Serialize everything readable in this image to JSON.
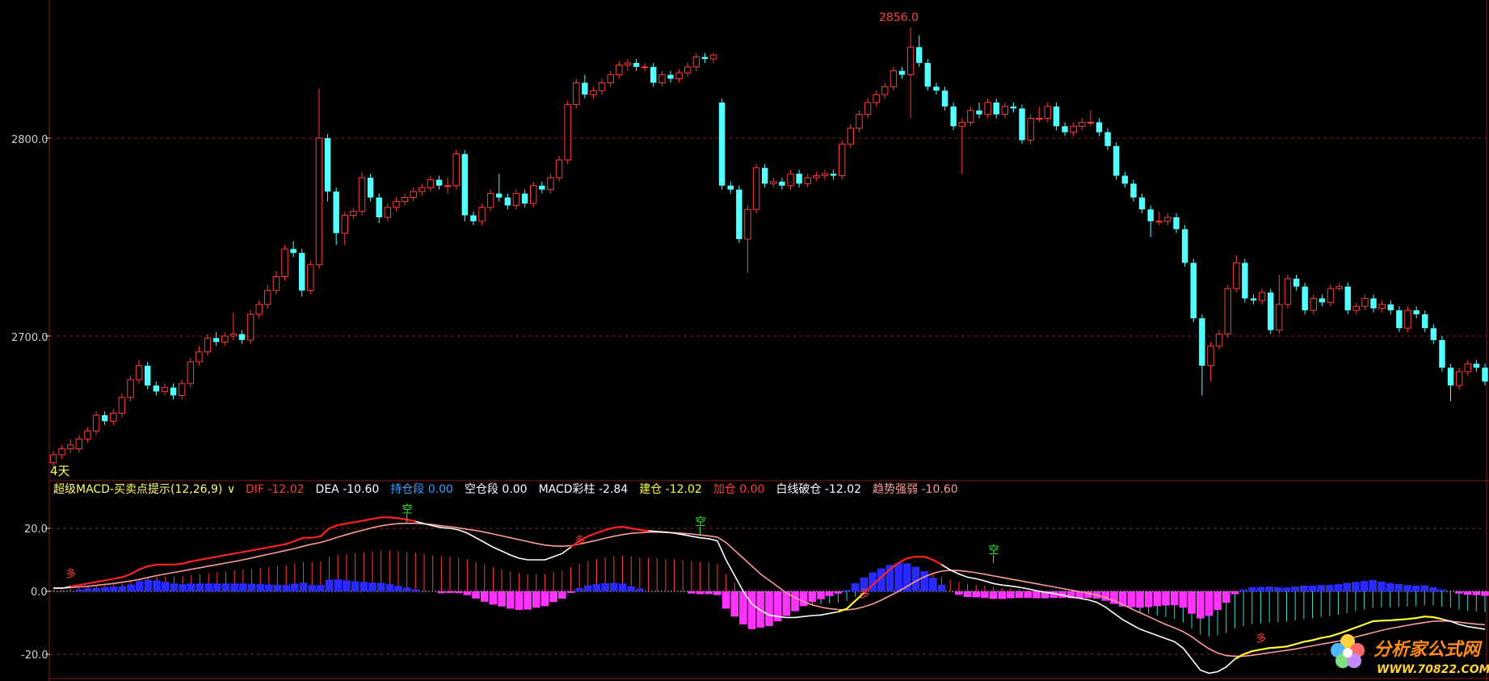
{
  "chart_data": {
    "type": "candlestick",
    "period_label": "4天",
    "price_axis": {
      "ticks": [
        "2800.0",
        "2700.0"
      ],
      "tick_values": [
        2800,
        2700
      ],
      "ylim": [
        2630,
        2875
      ],
      "gridlines": true
    },
    "high_marker": {
      "label": "2856.0",
      "value": 2856.0
    },
    "candles": [
      [
        2636,
        2640,
        2634,
        2642
      ],
      [
        2640,
        2643,
        2638,
        2645
      ],
      [
        2643,
        2645,
        2641,
        2648
      ],
      [
        2643,
        2648,
        2641,
        2650
      ],
      [
        2648,
        2652,
        2646,
        2654
      ],
      [
        2652,
        2660,
        2650,
        2662
      ],
      [
        2660,
        2657,
        2655,
        2662
      ],
      [
        2657,
        2661,
        2655,
        2663
      ],
      [
        2661,
        2669,
        2659,
        2671
      ],
      [
        2669,
        2678,
        2667,
        2680
      ],
      [
        2678,
        2685,
        2676,
        2688
      ],
      [
        2685,
        2675,
        2673,
        2687
      ],
      [
        2675,
        2672,
        2670,
        2677
      ],
      [
        2672,
        2674,
        2670,
        2676
      ],
      [
        2674,
        2670,
        2668,
        2676
      ],
      [
        2670,
        2676,
        2668,
        2678
      ],
      [
        2676,
        2687,
        2674,
        2689
      ],
      [
        2687,
        2692,
        2685,
        2695
      ],
      [
        2692,
        2699,
        2690,
        2701
      ],
      [
        2699,
        2697,
        2695,
        2702
      ],
      [
        2697,
        2700,
        2695,
        2702
      ],
      [
        2700,
        2701,
        2698,
        2712
      ],
      [
        2701,
        2698,
        2696,
        2703
      ],
      [
        2698,
        2711,
        2696,
        2713
      ],
      [
        2711,
        2716,
        2709,
        2718
      ],
      [
        2716,
        2723,
        2714,
        2726
      ],
      [
        2723,
        2730,
        2721,
        2733
      ],
      [
        2730,
        2744,
        2728,
        2746
      ],
      [
        2744,
        2742,
        2740,
        2748
      ],
      [
        2742,
        2723,
        2720,
        2744
      ],
      [
        2723,
        2736,
        2721,
        2738
      ],
      [
        2736,
        2800,
        2734,
        2825
      ],
      [
        2800,
        2773,
        2768,
        2802
      ],
      [
        2773,
        2752,
        2746,
        2775
      ],
      [
        2752,
        2761,
        2746,
        2763
      ],
      [
        2761,
        2763,
        2759,
        2765
      ],
      [
        2763,
        2780,
        2761,
        2783
      ],
      [
        2780,
        2770,
        2768,
        2782
      ],
      [
        2770,
        2760,
        2757,
        2772
      ],
      [
        2760,
        2765,
        2758,
        2767
      ],
      [
        2765,
        2768,
        2763,
        2770
      ],
      [
        2768,
        2770,
        2766,
        2772
      ],
      [
        2770,
        2773,
        2768,
        2775
      ],
      [
        2773,
        2775,
        2771,
        2777
      ],
      [
        2775,
        2779,
        2773,
        2781
      ],
      [
        2779,
        2776,
        2774,
        2781
      ],
      [
        2776,
        2776,
        2772,
        2780
      ],
      [
        2776,
        2792,
        2774,
        2794
      ],
      [
        2792,
        2761,
        2758,
        2794
      ],
      [
        2761,
        2758,
        2756,
        2763
      ],
      [
        2758,
        2765,
        2756,
        2767
      ],
      [
        2765,
        2772,
        2763,
        2774
      ],
      [
        2772,
        2770,
        2768,
        2782
      ],
      [
        2770,
        2766,
        2764,
        2772
      ],
      [
        2766,
        2772,
        2764,
        2774
      ],
      [
        2772,
        2767,
        2765,
        2774
      ],
      [
        2767,
        2776,
        2765,
        2778
      ],
      [
        2776,
        2774,
        2772,
        2778
      ],
      [
        2774,
        2780,
        2772,
        2782
      ],
      [
        2780,
        2789,
        2778,
        2791
      ],
      [
        2789,
        2817,
        2787,
        2819
      ],
      [
        2817,
        2828,
        2815,
        2830
      ],
      [
        2828,
        2822,
        2820,
        2832
      ],
      [
        2822,
        2824,
        2820,
        2826
      ],
      [
        2824,
        2828,
        2822,
        2830
      ],
      [
        2828,
        2832,
        2826,
        2834
      ],
      [
        2832,
        2837,
        2830,
        2839
      ],
      [
        2837,
        2838,
        2834,
        2840
      ],
      [
        2838,
        2836,
        2834,
        2840
      ],
      [
        2836,
        2836,
        2834,
        2838
      ],
      [
        2836,
        2828,
        2826,
        2838
      ],
      [
        2828,
        2832,
        2826,
        2834
      ],
      [
        2832,
        2830,
        2828,
        2834
      ],
      [
        2830,
        2833,
        2828,
        2835
      ],
      [
        2833,
        2836,
        2831,
        2838
      ],
      [
        2836,
        2841,
        2834,
        2843
      ],
      [
        2841,
        2840,
        2838,
        2843
      ],
      [
        2840,
        2842,
        2838,
        2843
      ],
      [
        2818,
        2776,
        2774,
        2820
      ],
      [
        2776,
        2774,
        2772,
        2778
      ],
      [
        2774,
        2749,
        2747,
        2776
      ],
      [
        2749,
        2764,
        2732,
        2766
      ],
      [
        2764,
        2785,
        2762,
        2787
      ],
      [
        2785,
        2777,
        2775,
        2787
      ],
      [
        2777,
        2778,
        2775,
        2780
      ],
      [
        2778,
        2776,
        2774,
        2780
      ],
      [
        2776,
        2782,
        2774,
        2784
      ],
      [
        2782,
        2777,
        2775,
        2784
      ],
      [
        2777,
        2780,
        2775,
        2782
      ],
      [
        2780,
        2781,
        2778,
        2783
      ],
      [
        2781,
        2782,
        2779,
        2784
      ],
      [
        2782,
        2781,
        2779,
        2784
      ],
      [
        2781,
        2797,
        2779,
        2799
      ],
      [
        2797,
        2805,
        2795,
        2807
      ],
      [
        2805,
        2812,
        2803,
        2814
      ],
      [
        2812,
        2818,
        2810,
        2820
      ],
      [
        2818,
        2822,
        2816,
        2824
      ],
      [
        2822,
        2826,
        2820,
        2828
      ],
      [
        2826,
        2834,
        2824,
        2836
      ],
      [
        2834,
        2832,
        2830,
        2836
      ],
      [
        2832,
        2846,
        2810,
        2856
      ],
      [
        2846,
        2838,
        2836,
        2852
      ],
      [
        2838,
        2826,
        2824,
        2840
      ],
      [
        2826,
        2824,
        2822,
        2828
      ],
      [
        2824,
        2816,
        2814,
        2826
      ],
      [
        2816,
        2806,
        2804,
        2818
      ],
      [
        2806,
        2808,
        2782,
        2810
      ],
      [
        2808,
        2814,
        2806,
        2816
      ],
      [
        2814,
        2812,
        2810,
        2818
      ],
      [
        2812,
        2818,
        2810,
        2820
      ],
      [
        2818,
        2812,
        2810,
        2820
      ],
      [
        2812,
        2816,
        2810,
        2818
      ],
      [
        2816,
        2815,
        2813,
        2818
      ],
      [
        2815,
        2799,
        2797,
        2817
      ],
      [
        2799,
        2810,
        2797,
        2812
      ],
      [
        2810,
        2810,
        2808,
        2816
      ],
      [
        2810,
        2816,
        2808,
        2818
      ],
      [
        2816,
        2806,
        2804,
        2818
      ],
      [
        2806,
        2803,
        2801,
        2808
      ],
      [
        2803,
        2806,
        2801,
        2808
      ],
      [
        2806,
        2808,
        2804,
        2810
      ],
      [
        2808,
        2808,
        2806,
        2814
      ],
      [
        2808,
        2803,
        2801,
        2810
      ],
      [
        2803,
        2796,
        2794,
        2805
      ],
      [
        2796,
        2781,
        2779,
        2798
      ],
      [
        2781,
        2777,
        2775,
        2783
      ],
      [
        2777,
        2770,
        2768,
        2779
      ],
      [
        2770,
        2764,
        2762,
        2772
      ],
      [
        2764,
        2758,
        2750,
        2766
      ],
      [
        2758,
        2758,
        2756,
        2763
      ],
      [
        2758,
        2760,
        2756,
        2762
      ],
      [
        2760,
        2754,
        2752,
        2762
      ],
      [
        2754,
        2737,
        2735,
        2756
      ],
      [
        2737,
        2709,
        2707,
        2739
      ],
      [
        2709,
        2685,
        2670,
        2711
      ],
      [
        2685,
        2695,
        2677,
        2697
      ],
      [
        2695,
        2701,
        2693,
        2703
      ],
      [
        2701,
        2724,
        2699,
        2726
      ],
      [
        2724,
        2737,
        2722,
        2741
      ],
      [
        2737,
        2719,
        2717,
        2739
      ],
      [
        2719,
        2718,
        2716,
        2721
      ],
      [
        2718,
        2722,
        2716,
        2724
      ],
      [
        2722,
        2703,
        2701,
        2724
      ],
      [
        2703,
        2716,
        2701,
        2731
      ],
      [
        2716,
        2729,
        2714,
        2731
      ],
      [
        2729,
        2725,
        2723,
        2731
      ],
      [
        2725,
        2713,
        2711,
        2727
      ],
      [
        2713,
        2719,
        2711,
        2721
      ],
      [
        2719,
        2717,
        2715,
        2721
      ],
      [
        2717,
        2724,
        2715,
        2726
      ],
      [
        2724,
        2725,
        2723,
        2727
      ],
      [
        2725,
        2713,
        2711,
        2727
      ],
      [
        2713,
        2715,
        2711,
        2717
      ],
      [
        2715,
        2719,
        2713,
        2721
      ],
      [
        2719,
        2714,
        2712,
        2721
      ],
      [
        2714,
        2716,
        2712,
        2718
      ],
      [
        2716,
        2713,
        2711,
        2718
      ],
      [
        2713,
        2704,
        2702,
        2715
      ],
      [
        2704,
        2713,
        2702,
        2715
      ],
      [
        2713,
        2711,
        2709,
        2715
      ],
      [
        2711,
        2704,
        2702,
        2713
      ],
      [
        2704,
        2698,
        2696,
        2706
      ],
      [
        2698,
        2684,
        2682,
        2700
      ],
      [
        2684,
        2675,
        2667,
        2686
      ],
      [
        2675,
        2682,
        2673,
        2684
      ],
      [
        2682,
        2686,
        2680,
        2688
      ],
      [
        2686,
        2684,
        2682,
        2688
      ],
      [
        2684,
        2677,
        2675,
        2686
      ]
    ],
    "indicator": {
      "name": "超级MACD-买卖点提示(12,26,9)",
      "dropdown_glyph": "∨",
      "legend": [
        {
          "label": "DIF",
          "value": "-12.02",
          "color": "#ff3b3b"
        },
        {
          "label": "DEA",
          "value": "-10.60",
          "color": "#ffffff"
        },
        {
          "label": "持仓段",
          "value": "0.00",
          "color": "#33a0ff"
        },
        {
          "label": "空仓段",
          "value": "0.00",
          "color": "#ffffff"
        },
        {
          "label": "MACD彩柱",
          "value": "-2.84",
          "color": "#ffffff"
        },
        {
          "label": "建仓",
          "value": "-12.02",
          "color": "#ffff33"
        },
        {
          "label": "加仓",
          "value": "0.00",
          "color": "#ff3b3b"
        },
        {
          "label": "白线破仓",
          "value": "-12.02",
          "color": "#ffffff"
        },
        {
          "label": "趋势强弱",
          "value": "-10.60",
          "color": "#ff9a9a"
        }
      ],
      "axis_ticks": [
        "20.0",
        "0.0",
        "-20.0"
      ],
      "axis_tick_values": [
        20,
        0,
        -20
      ],
      "ylim": [
        -28,
        27
      ],
      "dif": [
        1,
        1,
        1.5,
        2,
        2.5,
        3,
        3.5,
        4,
        4.5,
        5.5,
        7,
        8,
        8.5,
        8.5,
        8.5,
        8.8,
        9.5,
        10,
        10.5,
        11,
        11.5,
        12,
        12.5,
        13,
        13.5,
        14,
        14.5,
        15,
        16,
        17,
        17,
        17.5,
        20,
        21,
        21.5,
        22,
        22.5,
        23,
        23.5,
        23.5,
        23.2,
        22.8,
        22.2,
        21.5,
        20.8,
        20.2,
        20,
        19.5,
        18.5,
        17,
        15.5,
        14,
        12.8,
        11.5,
        10.5,
        10,
        10,
        10,
        11,
        12,
        14,
        16,
        17.5,
        18.5,
        19.5,
        20.2,
        20.5,
        20,
        19.5,
        19.2,
        19,
        18.8,
        18.5,
        18,
        17.5,
        17,
        16.7,
        16,
        10,
        5,
        0,
        -4,
        -6,
        -7.5,
        -8,
        -8.3,
        -8.3,
        -8,
        -7.7,
        -7.5,
        -7,
        -6.5,
        -5.5,
        -3,
        -0.5,
        2,
        4.5,
        7,
        9,
        10.5,
        11,
        11,
        10,
        8.5,
        6.8,
        5.5,
        4.5,
        4,
        3.3,
        2.5,
        2,
        1.7,
        1.3,
        0.8,
        0.2,
        -0.3,
        -0.7,
        -1.2,
        -1.8,
        -2.2,
        -2.7,
        -3.5,
        -5,
        -7,
        -9,
        -10.5,
        -12,
        -13,
        -14,
        -15,
        -16,
        -18,
        -21.5,
        -25,
        -26,
        -25.5,
        -24,
        -21.5,
        -20,
        -19,
        -18.5,
        -18,
        -17.8,
        -17.5,
        -16.8,
        -16,
        -15.5,
        -14.8,
        -14.3,
        -13.5,
        -12.5,
        -11.5,
        -10.5,
        -9.5,
        -9.3,
        -9.2,
        -9,
        -8.8,
        -8.5,
        -8,
        -8.2,
        -8.8,
        -9.5,
        -10.5,
        -11.2,
        -11.6,
        -12.02
      ],
      "dea": [
        1,
        1,
        1.2,
        1.4,
        1.6,
        1.9,
        2.2,
        2.5,
        2.9,
        3.3,
        3.8,
        4.4,
        5,
        5.5,
        6,
        6.5,
        7,
        7.5,
        8,
        8.5,
        9,
        9.5,
        10,
        10.6,
        11.2,
        11.8,
        12.4,
        13,
        13.6,
        14.3,
        15,
        15.5,
        16.3,
        17.2,
        18,
        18.8,
        19.5,
        20.2,
        20.8,
        21.2,
        21.5,
        21.6,
        21.6,
        21.4,
        21.2,
        20.8,
        20.5,
        20.1,
        19.7,
        19.3,
        18.8,
        18.2,
        17.6,
        17,
        16.4,
        15.8,
        15.2,
        14.7,
        14.4,
        14.3,
        14.5,
        15,
        15.6,
        16.2,
        16.9,
        17.5,
        18,
        18.4,
        18.6,
        18.8,
        18.8,
        18.7,
        18.6,
        18.4,
        18.2,
        17.9,
        17.6,
        17.2,
        15.5,
        13,
        10.5,
        8,
        5.5,
        3.5,
        1.5,
        -0.5,
        -2,
        -3.3,
        -4.3,
        -5,
        -5.5,
        -5.8,
        -5.9,
        -5.6,
        -4.9,
        -4,
        -2.8,
        -1.4,
        0,
        1.6,
        3.2,
        4.6,
        5.7,
        6.4,
        6.7,
        6.6,
        6.3,
        5.9,
        5.4,
        4.9,
        4.4,
        3.9,
        3.4,
        2.9,
        2.4,
        1.9,
        1.4,
        0.9,
        0.4,
        -0.1,
        -0.6,
        -1.2,
        -2,
        -3,
        -4.2,
        -5.5,
        -6.8,
        -8,
        -9.3,
        -10.5,
        -11.6,
        -12.8,
        -14.4,
        -16.4,
        -18.2,
        -19.6,
        -20.4,
        -20.6,
        -20.6,
        -20.3,
        -19.9,
        -19.5,
        -19.1,
        -18.7,
        -18.3,
        -17.8,
        -17.3,
        -16.8,
        -16.3,
        -15.8,
        -15.2,
        -14.5,
        -13.8,
        -13.1,
        -12.4,
        -11.8,
        -11.3,
        -10.8,
        -10.3,
        -9.9,
        -9.5,
        -9.4,
        -9.5,
        -9.8,
        -10.1,
        -10.4,
        -10.6
      ],
      "signals": [
        {
          "text": "多",
          "index": 2,
          "value": 3.5,
          "color": "#ff3b3b"
        },
        {
          "text": "空",
          "index": 41,
          "value": 24,
          "color": "#33ff33"
        },
        {
          "text": "多",
          "index": 61,
          "value": 14,
          "color": "#ff3b3b"
        },
        {
          "text": "空",
          "index": 75,
          "value": 20,
          "color": "#33ff33"
        },
        {
          "text": "多",
          "index": 94,
          "value": -3,
          "color": "#ff3b3b"
        },
        {
          "text": "空",
          "index": 109,
          "value": 11,
          "color": "#33ff33"
        },
        {
          "text": "多",
          "index": 140,
          "value": -17,
          "color": "#ff3b3b"
        },
        {
          "text": "空",
          "index": 167,
          "value": -4,
          "color": "#33ff33"
        }
      ]
    }
  },
  "watermark": {
    "brand": "分析家公式网",
    "url": "WWW.70822.COM"
  }
}
